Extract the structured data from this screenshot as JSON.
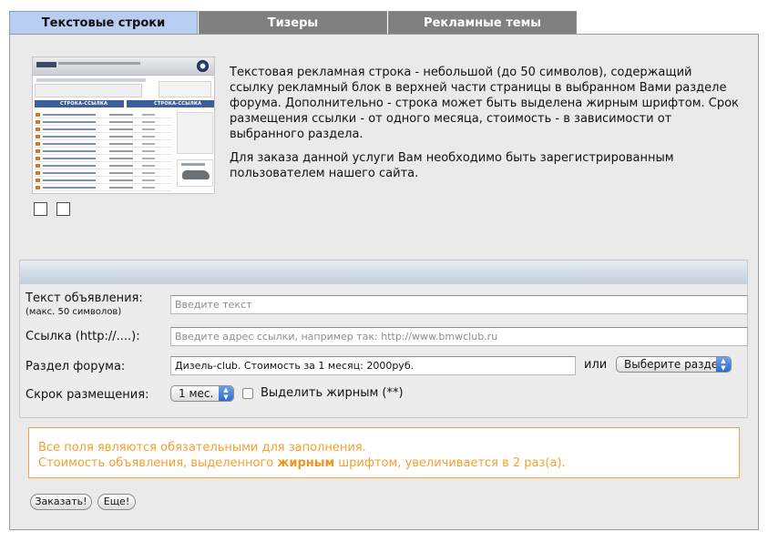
{
  "tabs": [
    {
      "label": "Текстовые строки",
      "active": true
    },
    {
      "label": "Тизеры",
      "active": false
    },
    {
      "label": "Рекламные темы",
      "active": false
    }
  ],
  "preview": {
    "bar_left": "СТРОКА-ССЫЛКА",
    "bar_right": "СТРОКА-ССЫЛКА"
  },
  "description": {
    "p1": "Текстовая рекламная строка - небольшой (до 50 символов), содержащий ссылку рекламный блок в верхней части страницы в выбранном Вами разделе форума. Дополнительно - строка может быть выделена жирным шрифтом. Срок размещения ссылки - от одного месяца, стоимость - в зависимости от выбранного раздела.",
    "p2": "Для заказа данной услуги Вам необходимо быть зарегистрированным пользователем нашего сайта."
  },
  "form": {
    "ad_text_label": "Текст объявления:",
    "ad_text_hint": "(макс. 50 символов)",
    "ad_text_placeholder": "Введите текст",
    "link_label": "Ссылка (http://....):",
    "link_placeholder": "Введите адрес ссылки, например так: http://www.bmwclub.ru",
    "section_label": "Раздел форума:",
    "section_value": "Дизель-club. Стоимость за 1 месяц: 2000руб.",
    "or_label": "или",
    "section_select": "Выберите раздел",
    "period_label": "Скрок размещения:",
    "period_select": "1 мес.",
    "bold_label": "Выделить жирным (**)"
  },
  "notice": {
    "line1": "Все поля являются обязательными для заполнения.",
    "line2_before": "Стоимость объявления, выделенного ",
    "line2_bold": "жирным",
    "line2_after": " шрифтом, увеличивается в 2 раз(а)."
  },
  "buttons": {
    "order": "Заказать!",
    "more": "Еще!"
  }
}
